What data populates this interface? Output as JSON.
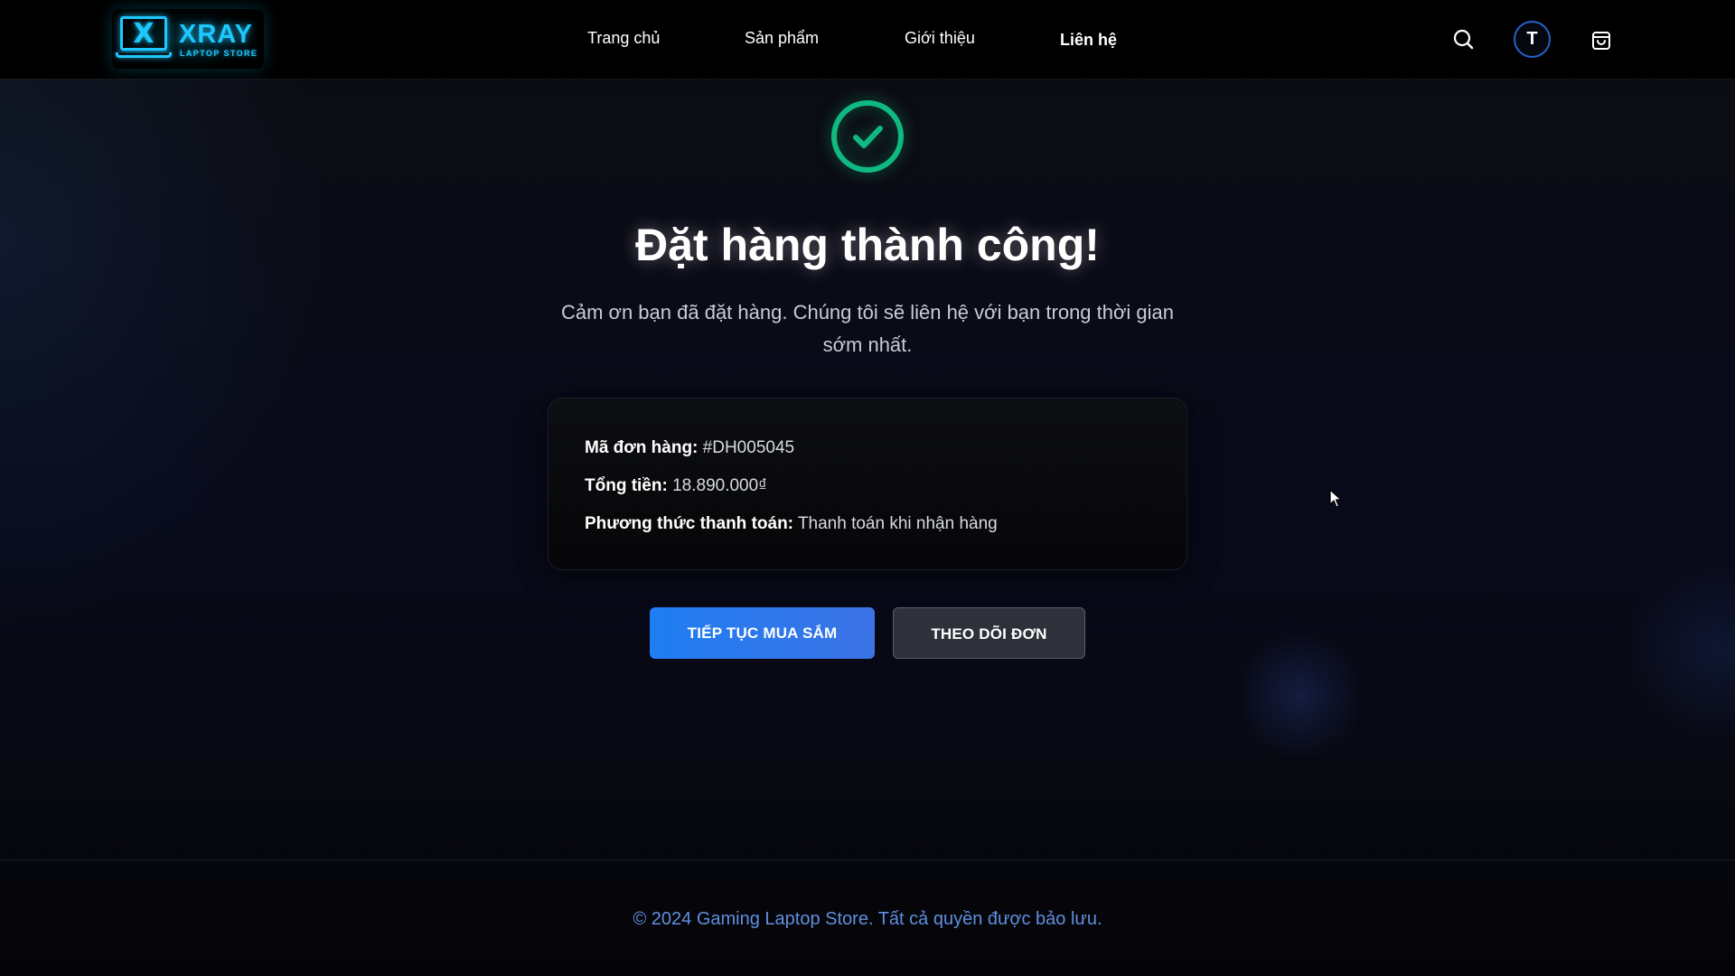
{
  "header": {
    "logo": {
      "brand": "XRAY",
      "tagline": "LAPTOP STORE",
      "screen_glyph": "X",
      "color": "#1ec8ff"
    },
    "nav": [
      {
        "label": "Trang chủ"
      },
      {
        "label": "Sản phẩm"
      },
      {
        "label": "Giới thiệu"
      },
      {
        "label": "Liên hệ",
        "active": true
      }
    ],
    "search_icon": "search-icon",
    "avatar_initial": "T",
    "cart_icon": "shopping-bag-icon"
  },
  "main": {
    "status_icon": "check-circle-icon",
    "status_color": "#10b981",
    "title": "Đặt hàng thành công!",
    "subtitle": "Cảm ơn bạn đã đặt hàng. Chúng tôi sẽ liên hệ với bạn trong thời gian sớm nhất.",
    "order": {
      "id_label": "Mã đơn hàng:",
      "id_value": "#DH005045",
      "total_label": "Tổng tiền:",
      "total_value": "18.890.000₫",
      "payment_label": "Phương thức thanh toán:",
      "payment_value": "Thanh toán khi nhận hàng"
    },
    "buttons": {
      "continue_label": "TIẾP TỤC MUA SẮM",
      "track_label": "THEO DÕI ĐƠN"
    }
  },
  "footer": {
    "copyright": "© 2024 Gaming Laptop Store. Tất cả quyền được bảo lưu."
  }
}
